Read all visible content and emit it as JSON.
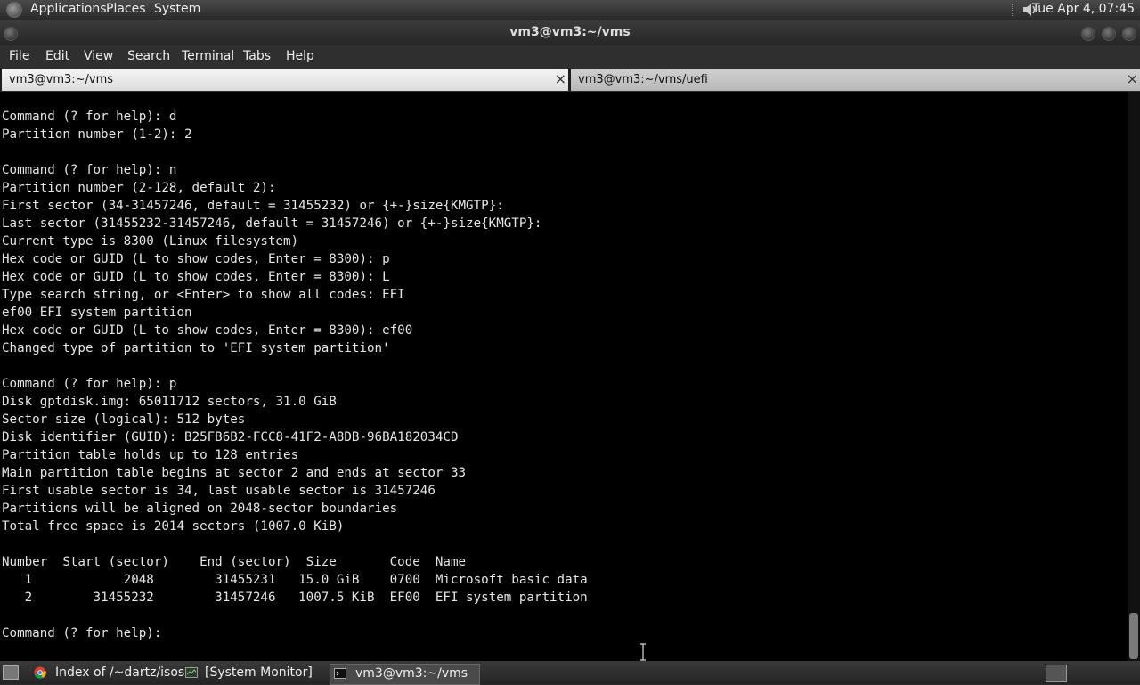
{
  "top_panel": {
    "menus": [
      "Applications",
      "Places",
      "System"
    ],
    "clock": "Tue Apr  4, 07:45"
  },
  "window": {
    "title": "vm3@vm3:~/vms"
  },
  "menubar": {
    "items": [
      "File",
      "Edit",
      "View",
      "Search",
      "Terminal",
      "Tabs",
      "Help"
    ]
  },
  "tabs": [
    {
      "label": "vm3@vm3:~/vms",
      "close": "×"
    },
    {
      "label": "vm3@vm3:~/vms/uefi",
      "close": "×"
    }
  ],
  "terminal": {
    "text": "Command (? for help): d\nPartition number (1-2): 2\n\nCommand (? for help): n\nPartition number (2-128, default 2):\nFirst sector (34-31457246, default = 31455232) or {+-}size{KMGTP}:\nLast sector (31455232-31457246, default = 31457246) or {+-}size{KMGTP}:\nCurrent type is 8300 (Linux filesystem)\nHex code or GUID (L to show codes, Enter = 8300): p\nHex code or GUID (L to show codes, Enter = 8300): L\nType search string, or <Enter> to show all codes: EFI\nef00 EFI system partition\nHex code or GUID (L to show codes, Enter = 8300): ef00\nChanged type of partition to 'EFI system partition'\n\nCommand (? for help): p\nDisk gptdisk.img: 65011712 sectors, 31.0 GiB\nSector size (logical): 512 bytes\nDisk identifier (GUID): B25FB6B2-FCC8-41F2-A8DB-96BA182034CD\nPartition table holds up to 128 entries\nMain partition table begins at sector 2 and ends at sector 33\nFirst usable sector is 34, last usable sector is 31457246\nPartitions will be aligned on 2048-sector boundaries\nTotal free space is 2014 sectors (1007.0 KiB)\n\nNumber  Start (sector)    End (sector)  Size       Code  Name\n   1            2048        31455231   15.0 GiB    0700  Microsoft basic data\n   2        31455232        31457246   1007.5 KiB  EF00  EFI system partition\n\nCommand (? for help):"
  },
  "taskbar": {
    "tasks": [
      {
        "label": "Index of /~dartz/isos..."
      },
      {
        "label": "[System Monitor]"
      },
      {
        "label": "vm3@vm3:~/vms"
      }
    ]
  }
}
